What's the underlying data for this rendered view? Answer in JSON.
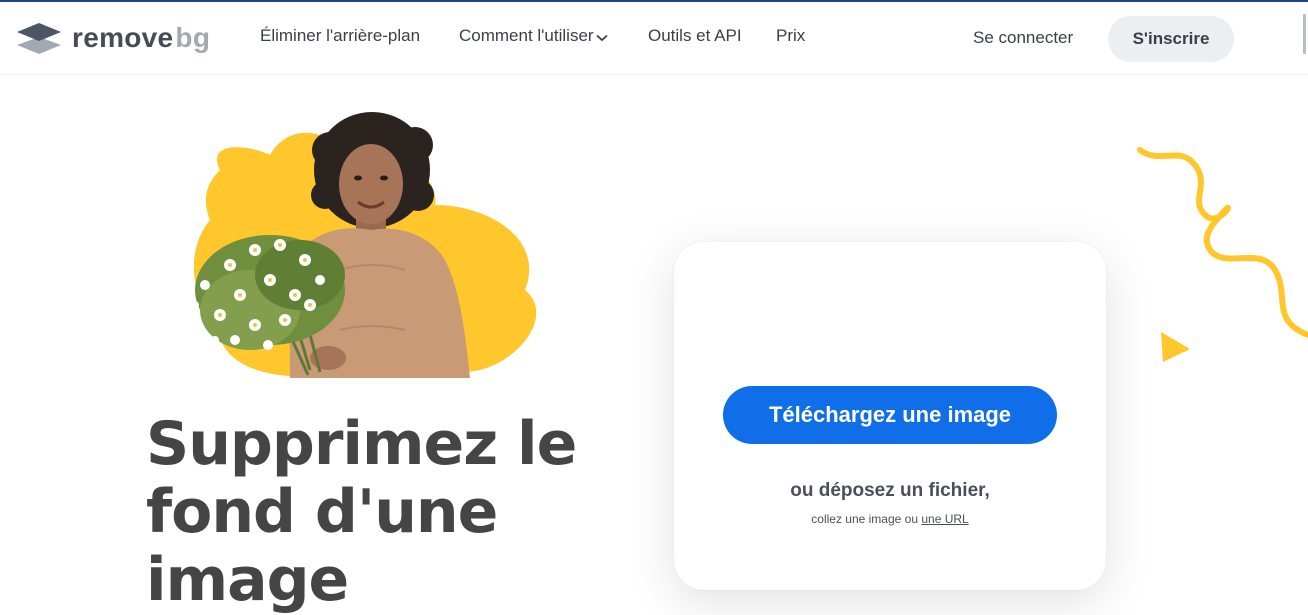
{
  "header": {
    "logo_main": "remove",
    "logo_accent": "bg",
    "nav": [
      {
        "label": "Éliminer l'arrière-plan"
      },
      {
        "label": "Comment l'utiliser"
      },
      {
        "label": "Outils et API"
      },
      {
        "label": "Prix"
      }
    ],
    "signin_label": "Se connecter",
    "signup_label": "S'inscrire"
  },
  "hero": {
    "headline": "Supprimez le fond d'une image",
    "image_icon": "woman-with-flowers-illustration"
  },
  "upload": {
    "button_label": "Téléchargez une image",
    "drop_text": "ou déposez un fichier,",
    "paste_text": "collez une image ou",
    "url_label": "une URL"
  },
  "colors": {
    "primary": "#0f6ee8",
    "accent_yellow": "#ffc72c",
    "text_dark": "#454545"
  }
}
